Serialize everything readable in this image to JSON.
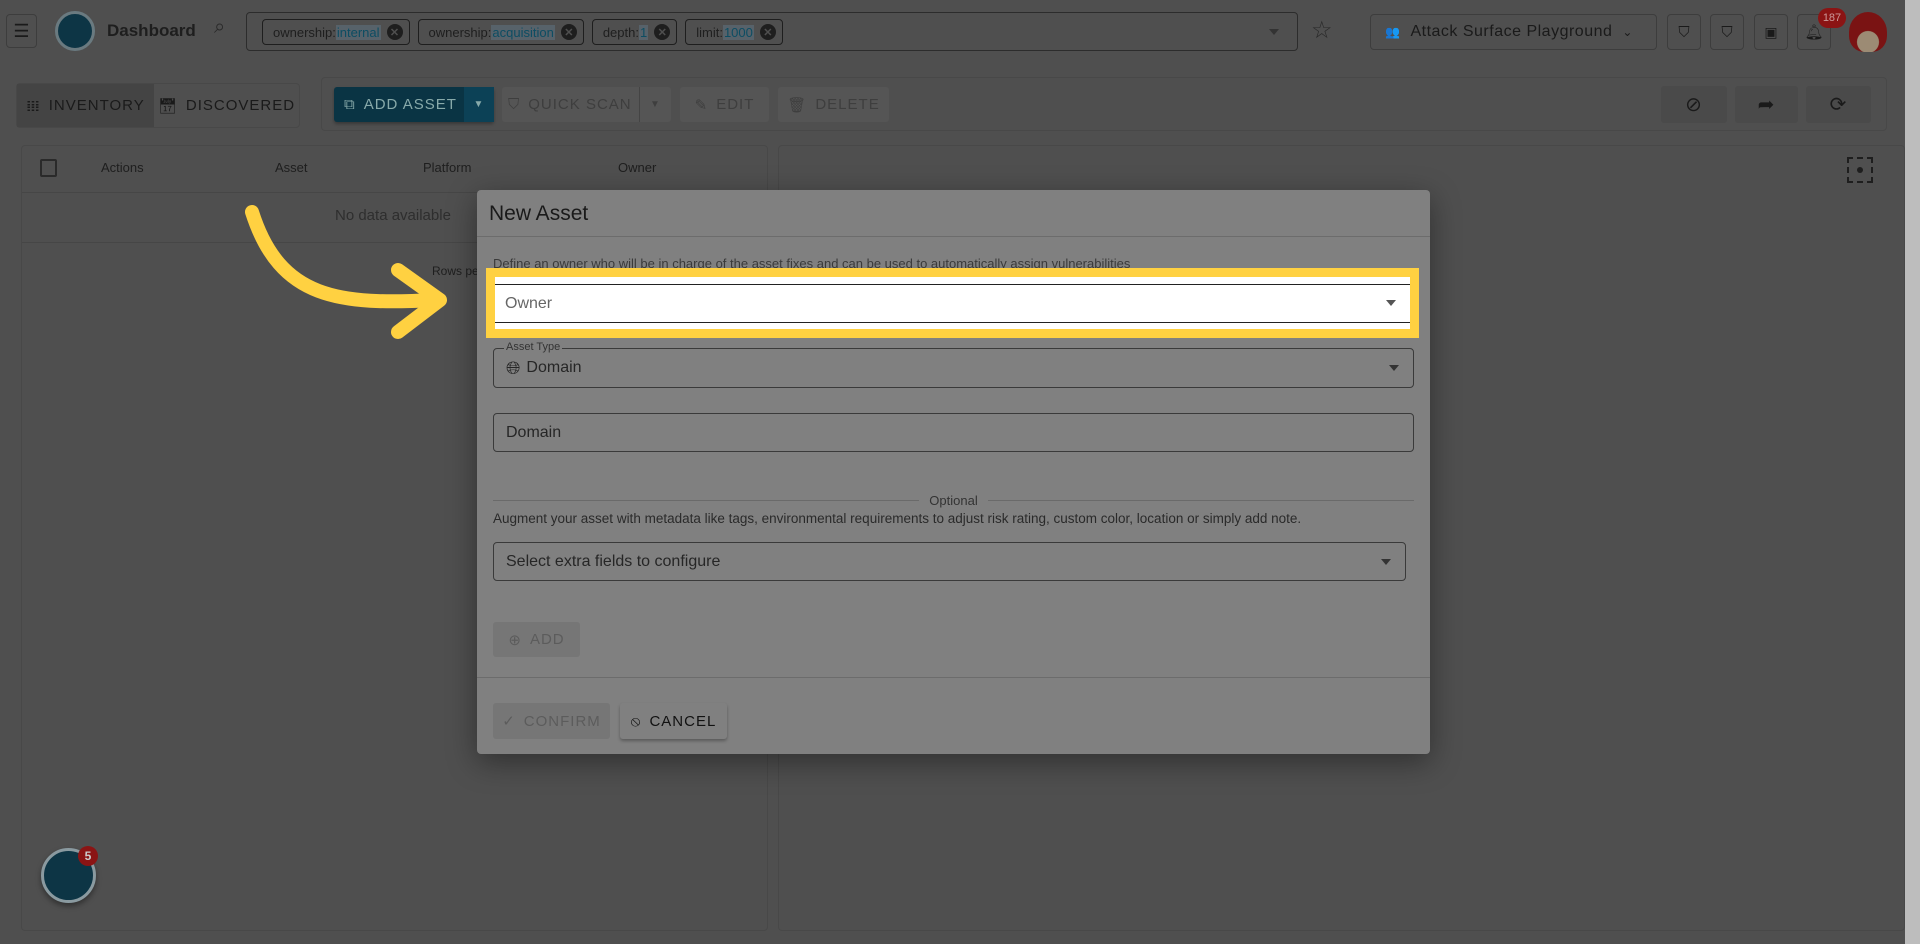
{
  "header": {
    "title": "Dashboard",
    "filters": [
      {
        "key": "ownership:",
        "value": "internal"
      },
      {
        "key": "ownership:",
        "value": "acquisition"
      },
      {
        "key": "depth:",
        "value": "1"
      },
      {
        "key": "limit:",
        "value": "1000"
      }
    ],
    "workspace": "Attack Surface Playground",
    "notification_count": "187"
  },
  "tabs": {
    "inventory": "INVENTORY",
    "discovered": "DISCOVERED"
  },
  "toolbar": {
    "add_asset": "ADD ASSET",
    "quick_scan": "QUICK SCAN",
    "edit": "EDIT",
    "delete": "DELETE"
  },
  "table": {
    "columns": [
      "Actions",
      "Asset",
      "Platform",
      "Owner"
    ],
    "empty": "No data available",
    "rows_per_page": "Rows pe"
  },
  "dialog": {
    "title": "New Asset",
    "owner_help": "Define an owner who will be in charge of the asset fixes and can be used to automatically assign vulnerabilities",
    "owner_placeholder": "Owner",
    "asset_type_label": "Asset Type",
    "asset_type_value": "Domain",
    "domain_placeholder": "Domain",
    "optional_label": "Optional",
    "optional_help": "Augment your asset with metadata like tags, environmental requirements to adjust risk rating, custom color, location or simply add note.",
    "extra_fields_placeholder": "Select extra fields to configure",
    "add": "ADD",
    "confirm": "CONFIRM",
    "cancel": "CANCEL"
  },
  "assistant_badge": "5",
  "colors": {
    "highlight": "#ffd141",
    "brand": "#0d4d63",
    "badge": "#8b1414"
  }
}
